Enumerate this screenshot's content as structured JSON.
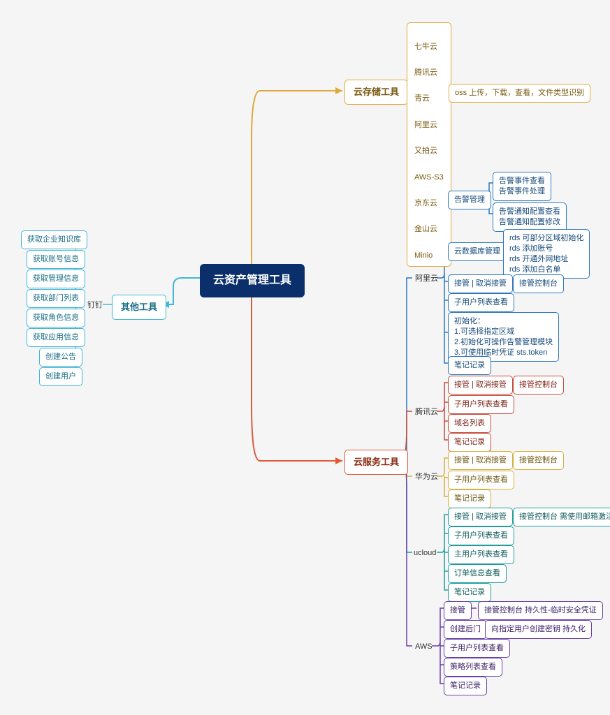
{
  "root": "云资产管理工具",
  "branch_other": {
    "title": "其他工具",
    "via": "钉钉",
    "items": [
      "获取企业知识库",
      "获取账号信息",
      "获取管理信息",
      "获取部门列表",
      "获取角色信息",
      "获取应用信息",
      "创建公告",
      "创建用户"
    ]
  },
  "branch_storage": {
    "title": "云存储工具",
    "providers": [
      "七牛云",
      "腾讯云",
      "青云",
      "阿里云",
      "又拍云",
      "AWS-S3",
      "京东云",
      "金山云",
      "Minio"
    ],
    "capability": "oss 上传，下载，查看，文件类型识别"
  },
  "branch_service": {
    "title": "云服务工具",
    "providers": {
      "aliyun": {
        "label": "阿里云",
        "children": [
          {
            "label": "告警管理",
            "sub": [
              "告警事件查看\n告警事件处理",
              "告警通知配置查看\n告警通知配置修改"
            ]
          },
          {
            "label": "云数据库管理",
            "sub": [
              "rds 可部分区域初始化\nrds 添加账号\nrds 开通外网地址\nrds 添加白名单"
            ]
          },
          {
            "label": "接管 | 取消接管",
            "sub": [
              "接管控制台"
            ]
          },
          {
            "label": "子用户列表查看"
          },
          {
            "label": "初始化：\n1.可选择指定区域\n2.初始化可操作告警管理模块\n3.可使用临时凭证 sts.token"
          },
          {
            "label": "笔记记录"
          }
        ]
      },
      "tencent": {
        "label": "腾讯云",
        "children": [
          {
            "label": "接管 | 取消接管",
            "sub": [
              "接管控制台"
            ]
          },
          {
            "label": "子用户列表查看"
          },
          {
            "label": "域名列表"
          },
          {
            "label": "笔记记录"
          }
        ]
      },
      "huawei": {
        "label": "华为云",
        "children": [
          {
            "label": "接管 | 取消接管",
            "sub": [
              "接管控制台"
            ]
          },
          {
            "label": "子用户列表查看"
          },
          {
            "label": "笔记记录"
          }
        ]
      },
      "ucloud": {
        "label": "ucloud",
        "children": [
          {
            "label": "接管 | 取消接管",
            "sub": [
              "接管控制台 需使用邮箱激活"
            ]
          },
          {
            "label": "子用户列表查看"
          },
          {
            "label": "主用户列表查看"
          },
          {
            "label": "订单信息查看"
          },
          {
            "label": "笔记记录"
          }
        ]
      },
      "aws": {
        "label": "AWS",
        "children": [
          {
            "label": "接管",
            "sub": [
              "接管控制台 持久性-临时安全凭证"
            ]
          },
          {
            "label": "创建后门",
            "sub": [
              "向指定用户创建密钥 持久化"
            ]
          },
          {
            "label": "子用户列表查看"
          },
          {
            "label": "策略列表查看"
          },
          {
            "label": "笔记记录"
          }
        ]
      }
    }
  }
}
